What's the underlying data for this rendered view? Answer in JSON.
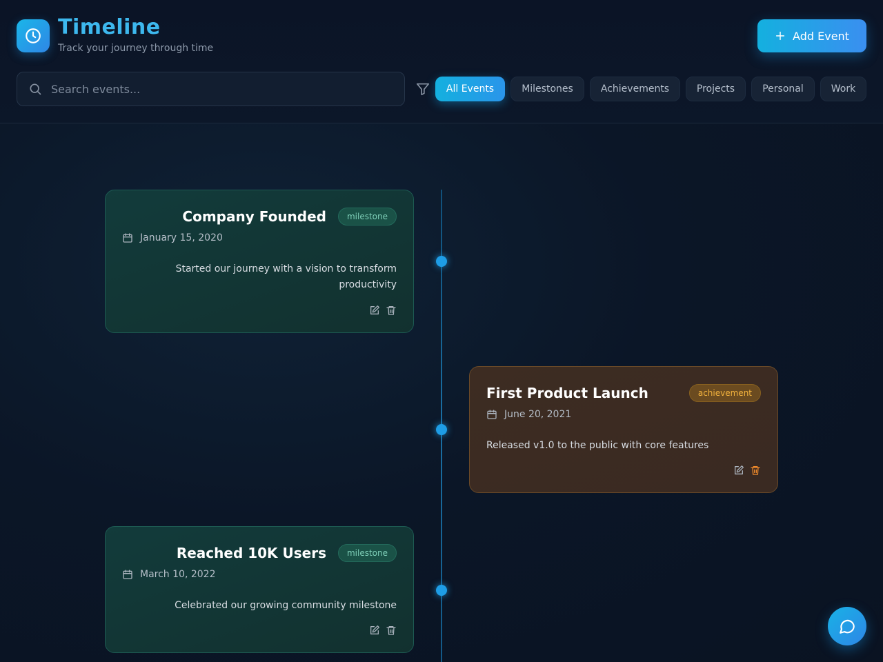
{
  "header": {
    "title": "Timeline",
    "subtitle": "Track your journey through time",
    "add_button_label": "Add Event"
  },
  "search": {
    "placeholder": "Search events..."
  },
  "filters": [
    {
      "label": "All Events",
      "active": true
    },
    {
      "label": "Milestones",
      "active": false
    },
    {
      "label": "Achievements",
      "active": false
    },
    {
      "label": "Projects",
      "active": false
    },
    {
      "label": "Personal",
      "active": false
    },
    {
      "label": "Work",
      "active": false
    }
  ],
  "events": [
    {
      "title": "Company Founded",
      "badge": "milestone",
      "date": "January 15, 2020",
      "description_line1": "Started our journey with a vision to transform",
      "description_line2": "productivity"
    },
    {
      "title": "First Product Launch",
      "badge": "achievement",
      "date": "June 20, 2021",
      "description_line1": "Released v1.0 to the public with core features",
      "description_line2": ""
    },
    {
      "title": "Reached 10K Users",
      "badge": "milestone",
      "date": "March 10, 2022",
      "description_line1": "Celebrated our growing community milestone",
      "description_line2": ""
    }
  ],
  "colors": {
    "accent": "#1ab6e8",
    "milestone": "#7fd0b9",
    "achievement": "#f2b23d",
    "background": "#0b1526"
  },
  "icons": {
    "logo": "clock-icon",
    "add": "plus-icon",
    "search": "search-icon",
    "filter": "filter-icon",
    "date": "calendar-icon",
    "edit": "edit-icon",
    "delete": "trash-icon",
    "chat": "chat-bubble-icon"
  }
}
